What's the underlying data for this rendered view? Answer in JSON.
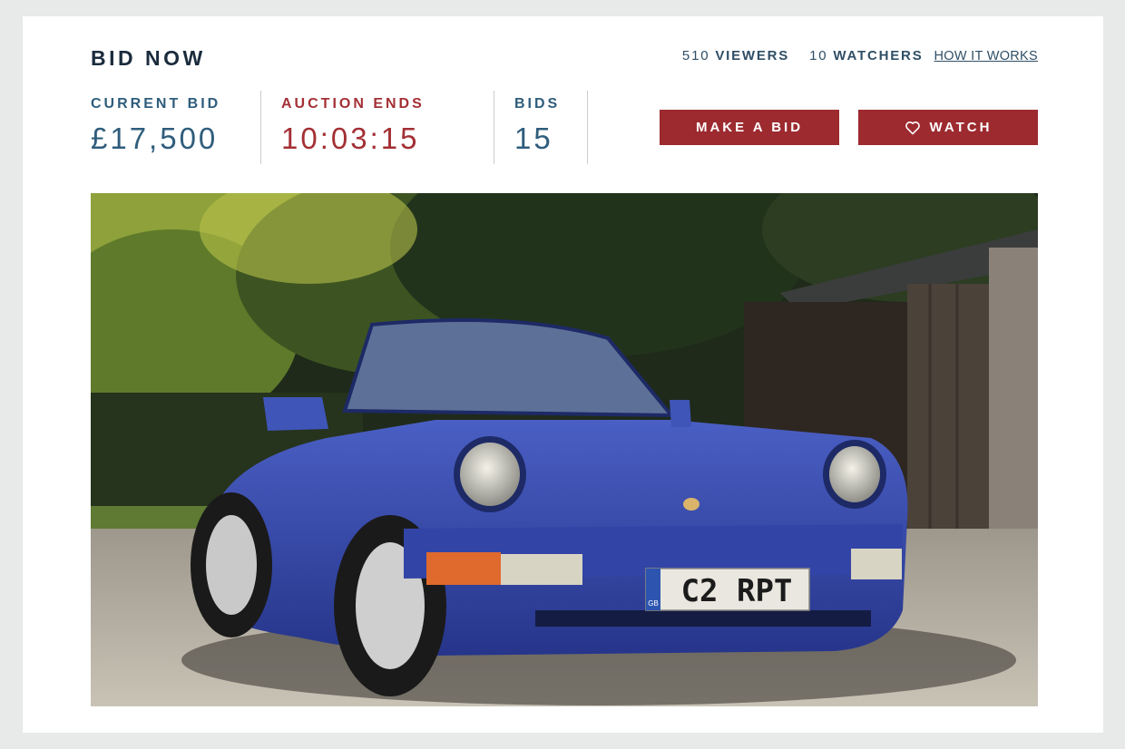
{
  "header": {
    "title": "BID NOW",
    "viewers_count": "510",
    "viewers_label": "VIEWERS",
    "watchers_count": "10",
    "watchers_label": "WATCHERS",
    "how_it_works": "HOW IT WORKS"
  },
  "metrics": {
    "current_bid_label": "CURRENT BID",
    "current_bid_value": "£17,500",
    "auction_ends_label": "AUCTION ENDS",
    "auction_ends_value": "10:03:15",
    "bids_label": "BIDS",
    "bids_value": "15"
  },
  "actions": {
    "make_bid_label": "MAKE A BID",
    "watch_label": "WATCH",
    "watch_icon": "heart-icon"
  },
  "photo": {
    "plate_text": "C2 RPT",
    "plate_badge": "GB"
  },
  "colors": {
    "accent_red": "#9c2a2f",
    "navy": "#1a2b3c",
    "steel_blue": "#2f5d7c",
    "background": "#e8e9e9"
  }
}
